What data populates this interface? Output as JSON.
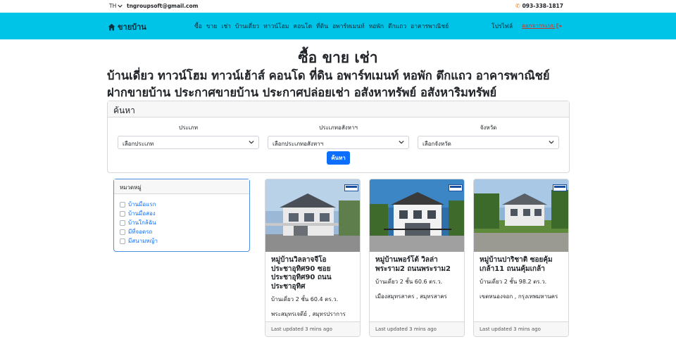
{
  "topbar": {
    "lang": "TH",
    "email": "tngroupsoft@gmail.com",
    "phone": "093-338-1817"
  },
  "navbar": {
    "brand": "ขายบ้าน",
    "links": [
      "ซื้อ",
      "ขาย",
      "เช่า",
      "บ้านเดี่ยว",
      "ทาวน์โฮม",
      "คอนโด",
      "ที่ดิน",
      "อพาร์ทเมนท์",
      "หอพัก",
      "ตึกแถว",
      "อาคารพาณิชย์"
    ],
    "profile": "โปรไฟล์",
    "logout": "ออกจากระบบ"
  },
  "hero": {
    "title": "ซื้อ ขาย เช่า",
    "line1": "บ้านเดี่ยว ทาวน์โฮม ทาวน์เฮ้าส์ คอนโด ที่ดิน อพาร์ทเมนท์ หอพัก ตึกแถว อาคารพาณิชย์",
    "line2": "ฝากขายบ้าน ประกาศขายบ้าน ประกาศปล่อยเช่า อสังหาทรัพย์ อสังหาริมทรัพย์"
  },
  "search": {
    "heading": "ค้นหา",
    "type_label": "ประเภท",
    "type_value": "เลือกประเภท",
    "property_label": "ประเภทอสังหาฯ",
    "property_value": "เลือกประเภทอสังหาฯ",
    "province_label": "จังหวัด",
    "province_value": "เลือกจังหวัด",
    "button": "ค้นหา"
  },
  "categories": {
    "heading": "หมวดหมู่",
    "items": [
      "บ้านมือแรก",
      "บ้านมือสอง",
      "บ้านใกล้ฉัน",
      "มีที่จอดรถ",
      "มีสนามหญ้า"
    ]
  },
  "listings": [
    {
      "title": "หมู่บ้านวิลลาจจีโอ ประชาอุทิศ90 ซอยประชาอุทิศ90 ถนนประชาอุทิศ",
      "spec": "บ้านเดี่ยว 2 ชั้น 60.4 ตร.ว.",
      "location": "พระสมุทรเจดีย์ , สมุทรปราการ",
      "updated": "Last updated 3 mins ago"
    },
    {
      "title": "หมู่บ้านพอร์โต้ วิลล่า พระราม2 ถนนพระราม2",
      "spec": "บ้านเดี่ยว 2 ชั้น 60.6 ตร.ว.",
      "location": "เมืองสมุทรสาคร , สมุทรสาคร",
      "updated": "Last updated 3 mins ago"
    },
    {
      "title": "หมู่บ้านปาริชาติ ซอยคุ้มเกล้า11 ถนนคุ้มเกล้า",
      "spec": "บ้านเดี่ยว 2 ชั้น 98.2 ตร.ว.",
      "location": "เขตหนองจอก , กรุงเทพมหานคร",
      "updated": "Last updated 3 mins ago"
    }
  ],
  "colors": {
    "navbar": "#00c3e8",
    "primary": "#0d6efd",
    "logout": "#c0392b"
  }
}
